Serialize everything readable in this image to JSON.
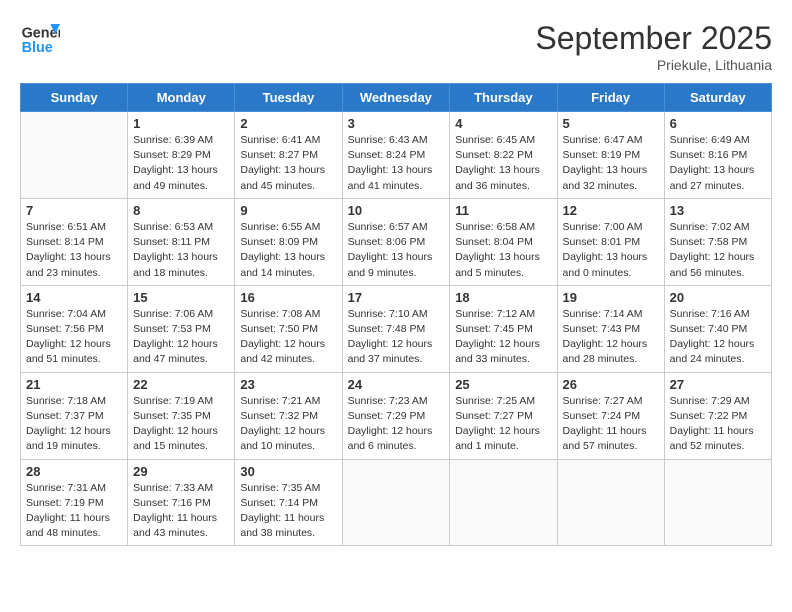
{
  "header": {
    "logo_general": "General",
    "logo_blue": "Blue",
    "month_title": "September 2025",
    "subtitle": "Priekule, Lithuania"
  },
  "days_of_week": [
    "Sunday",
    "Monday",
    "Tuesday",
    "Wednesday",
    "Thursday",
    "Friday",
    "Saturday"
  ],
  "weeks": [
    [
      {
        "day": "",
        "info": ""
      },
      {
        "day": "1",
        "info": "Sunrise: 6:39 AM\nSunset: 8:29 PM\nDaylight: 13 hours\nand 49 minutes."
      },
      {
        "day": "2",
        "info": "Sunrise: 6:41 AM\nSunset: 8:27 PM\nDaylight: 13 hours\nand 45 minutes."
      },
      {
        "day": "3",
        "info": "Sunrise: 6:43 AM\nSunset: 8:24 PM\nDaylight: 13 hours\nand 41 minutes."
      },
      {
        "day": "4",
        "info": "Sunrise: 6:45 AM\nSunset: 8:22 PM\nDaylight: 13 hours\nand 36 minutes."
      },
      {
        "day": "5",
        "info": "Sunrise: 6:47 AM\nSunset: 8:19 PM\nDaylight: 13 hours\nand 32 minutes."
      },
      {
        "day": "6",
        "info": "Sunrise: 6:49 AM\nSunset: 8:16 PM\nDaylight: 13 hours\nand 27 minutes."
      }
    ],
    [
      {
        "day": "7",
        "info": "Sunrise: 6:51 AM\nSunset: 8:14 PM\nDaylight: 13 hours\nand 23 minutes."
      },
      {
        "day": "8",
        "info": "Sunrise: 6:53 AM\nSunset: 8:11 PM\nDaylight: 13 hours\nand 18 minutes."
      },
      {
        "day": "9",
        "info": "Sunrise: 6:55 AM\nSunset: 8:09 PM\nDaylight: 13 hours\nand 14 minutes."
      },
      {
        "day": "10",
        "info": "Sunrise: 6:57 AM\nSunset: 8:06 PM\nDaylight: 13 hours\nand 9 minutes."
      },
      {
        "day": "11",
        "info": "Sunrise: 6:58 AM\nSunset: 8:04 PM\nDaylight: 13 hours\nand 5 minutes."
      },
      {
        "day": "12",
        "info": "Sunrise: 7:00 AM\nSunset: 8:01 PM\nDaylight: 13 hours\nand 0 minutes."
      },
      {
        "day": "13",
        "info": "Sunrise: 7:02 AM\nSunset: 7:58 PM\nDaylight: 12 hours\nand 56 minutes."
      }
    ],
    [
      {
        "day": "14",
        "info": "Sunrise: 7:04 AM\nSunset: 7:56 PM\nDaylight: 12 hours\nand 51 minutes."
      },
      {
        "day": "15",
        "info": "Sunrise: 7:06 AM\nSunset: 7:53 PM\nDaylight: 12 hours\nand 47 minutes."
      },
      {
        "day": "16",
        "info": "Sunrise: 7:08 AM\nSunset: 7:50 PM\nDaylight: 12 hours\nand 42 minutes."
      },
      {
        "day": "17",
        "info": "Sunrise: 7:10 AM\nSunset: 7:48 PM\nDaylight: 12 hours\nand 37 minutes."
      },
      {
        "day": "18",
        "info": "Sunrise: 7:12 AM\nSunset: 7:45 PM\nDaylight: 12 hours\nand 33 minutes."
      },
      {
        "day": "19",
        "info": "Sunrise: 7:14 AM\nSunset: 7:43 PM\nDaylight: 12 hours\nand 28 minutes."
      },
      {
        "day": "20",
        "info": "Sunrise: 7:16 AM\nSunset: 7:40 PM\nDaylight: 12 hours\nand 24 minutes."
      }
    ],
    [
      {
        "day": "21",
        "info": "Sunrise: 7:18 AM\nSunset: 7:37 PM\nDaylight: 12 hours\nand 19 minutes."
      },
      {
        "day": "22",
        "info": "Sunrise: 7:19 AM\nSunset: 7:35 PM\nDaylight: 12 hours\nand 15 minutes."
      },
      {
        "day": "23",
        "info": "Sunrise: 7:21 AM\nSunset: 7:32 PM\nDaylight: 12 hours\nand 10 minutes."
      },
      {
        "day": "24",
        "info": "Sunrise: 7:23 AM\nSunset: 7:29 PM\nDaylight: 12 hours\nand 6 minutes."
      },
      {
        "day": "25",
        "info": "Sunrise: 7:25 AM\nSunset: 7:27 PM\nDaylight: 12 hours\nand 1 minute."
      },
      {
        "day": "26",
        "info": "Sunrise: 7:27 AM\nSunset: 7:24 PM\nDaylight: 11 hours\nand 57 minutes."
      },
      {
        "day": "27",
        "info": "Sunrise: 7:29 AM\nSunset: 7:22 PM\nDaylight: 11 hours\nand 52 minutes."
      }
    ],
    [
      {
        "day": "28",
        "info": "Sunrise: 7:31 AM\nSunset: 7:19 PM\nDaylight: 11 hours\nand 48 minutes."
      },
      {
        "day": "29",
        "info": "Sunrise: 7:33 AM\nSunset: 7:16 PM\nDaylight: 11 hours\nand 43 minutes."
      },
      {
        "day": "30",
        "info": "Sunrise: 7:35 AM\nSunset: 7:14 PM\nDaylight: 11 hours\nand 38 minutes."
      },
      {
        "day": "",
        "info": ""
      },
      {
        "day": "",
        "info": ""
      },
      {
        "day": "",
        "info": ""
      },
      {
        "day": "",
        "info": ""
      }
    ]
  ]
}
